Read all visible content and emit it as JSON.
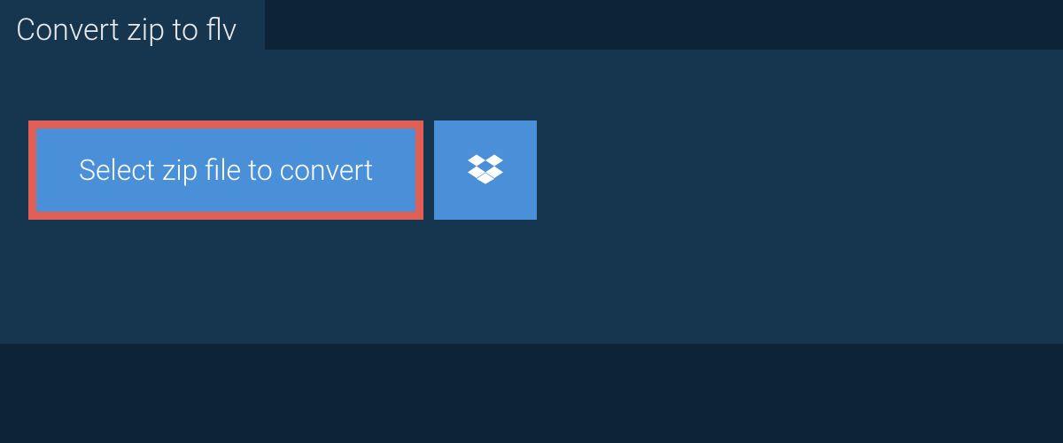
{
  "tab": {
    "title": "Convert zip to flv"
  },
  "actions": {
    "select_file_label": "Select zip file to convert"
  }
}
